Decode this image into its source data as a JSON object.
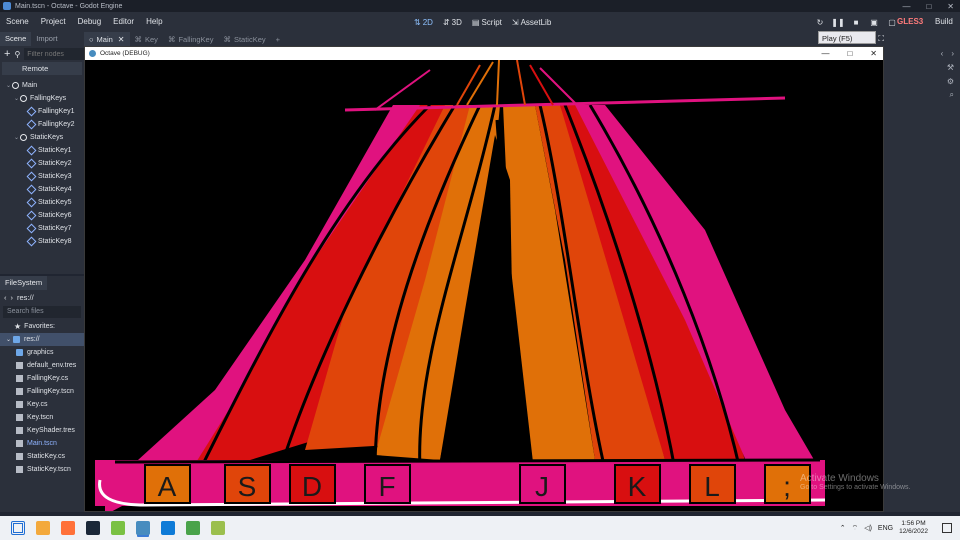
{
  "window": {
    "title": "Main.tscn - Octave - Godot Engine",
    "controls": [
      "—",
      "□",
      "✕"
    ]
  },
  "menu": [
    "Scene",
    "Project",
    "Debug",
    "Editor",
    "Help"
  ],
  "main_screens": [
    {
      "label": "2D",
      "icon": "2d-icon",
      "active": true
    },
    {
      "label": "3D",
      "icon": "3d-icon",
      "active": false
    },
    {
      "label": "Script",
      "icon": "script-icon",
      "active": false
    },
    {
      "label": "AssetLib",
      "icon": "assetlib-icon",
      "active": false
    }
  ],
  "renderer": "GLES3",
  "build_label": "Build",
  "tooltip": "Play (F5)",
  "scene_dock": {
    "tabs": [
      "Scene",
      "Import"
    ],
    "filter_placeholder": "Filter nodes",
    "remote_label": "Remote",
    "tree": [
      {
        "label": "Main",
        "depth": 0,
        "type": "node"
      },
      {
        "label": "FallingKeys",
        "depth": 1,
        "type": "node"
      },
      {
        "label": "FallingKey1",
        "depth": 2,
        "type": "key"
      },
      {
        "label": "FallingKey2",
        "depth": 2,
        "type": "key"
      },
      {
        "label": "StaticKeys",
        "depth": 1,
        "type": "node"
      },
      {
        "label": "StaticKey1",
        "depth": 2,
        "type": "key"
      },
      {
        "label": "StaticKey2",
        "depth": 2,
        "type": "key"
      },
      {
        "label": "StaticKey3",
        "depth": 2,
        "type": "key"
      },
      {
        "label": "StaticKey4",
        "depth": 2,
        "type": "key"
      },
      {
        "label": "StaticKey5",
        "depth": 2,
        "type": "key"
      },
      {
        "label": "StaticKey6",
        "depth": 2,
        "type": "key"
      },
      {
        "label": "StaticKey7",
        "depth": 2,
        "type": "key"
      },
      {
        "label": "StaticKey8",
        "depth": 2,
        "type": "key"
      }
    ]
  },
  "filesystem": {
    "title": "FileSystem",
    "path": "res://",
    "search_placeholder": "Search files",
    "favorites_label": "Favorites:",
    "root_label": "res://",
    "items": [
      {
        "label": "graphics",
        "type": "folder"
      },
      {
        "label": "default_env.tres",
        "type": "file"
      },
      {
        "label": "FallingKey.cs",
        "type": "file"
      },
      {
        "label": "FallingKey.tscn",
        "type": "file"
      },
      {
        "label": "Key.cs",
        "type": "file"
      },
      {
        "label": "Key.tscn",
        "type": "file"
      },
      {
        "label": "KeyShader.tres",
        "type": "file"
      },
      {
        "label": "Main.tscn",
        "type": "file",
        "highlight": true
      },
      {
        "label": "StaticKey.cs",
        "type": "file"
      },
      {
        "label": "StaticKey.tscn",
        "type": "file"
      }
    ]
  },
  "scene_tabs": [
    {
      "label": "Main",
      "active": true
    },
    {
      "label": "Key",
      "active": false
    },
    {
      "label": "FallingKey",
      "active": false
    },
    {
      "label": "StaticKey",
      "active": false
    }
  ],
  "game_window": {
    "title": "Octave (DEBUG)",
    "keys": [
      "A",
      "S",
      "D",
      "F",
      "J",
      "K",
      "L",
      ";"
    ],
    "lane_colors": [
      "#e0127f",
      "#d80f10",
      "#e0450a",
      "#e07008"
    ]
  },
  "watermark": {
    "line1": "Activate Windows",
    "line2": "Go to Settings to activate Windows."
  },
  "taskbar": {
    "icons": [
      "start-icon",
      "file-explorer-icon",
      "firefox-icon",
      "steam-icon",
      "app-icon",
      "godot-icon",
      "visual-studio-icon",
      "paint-icon",
      "notepad-icon"
    ],
    "tray_language": "ENG",
    "clock_time": "1:56 PM",
    "clock_date": "12/6/2022"
  }
}
